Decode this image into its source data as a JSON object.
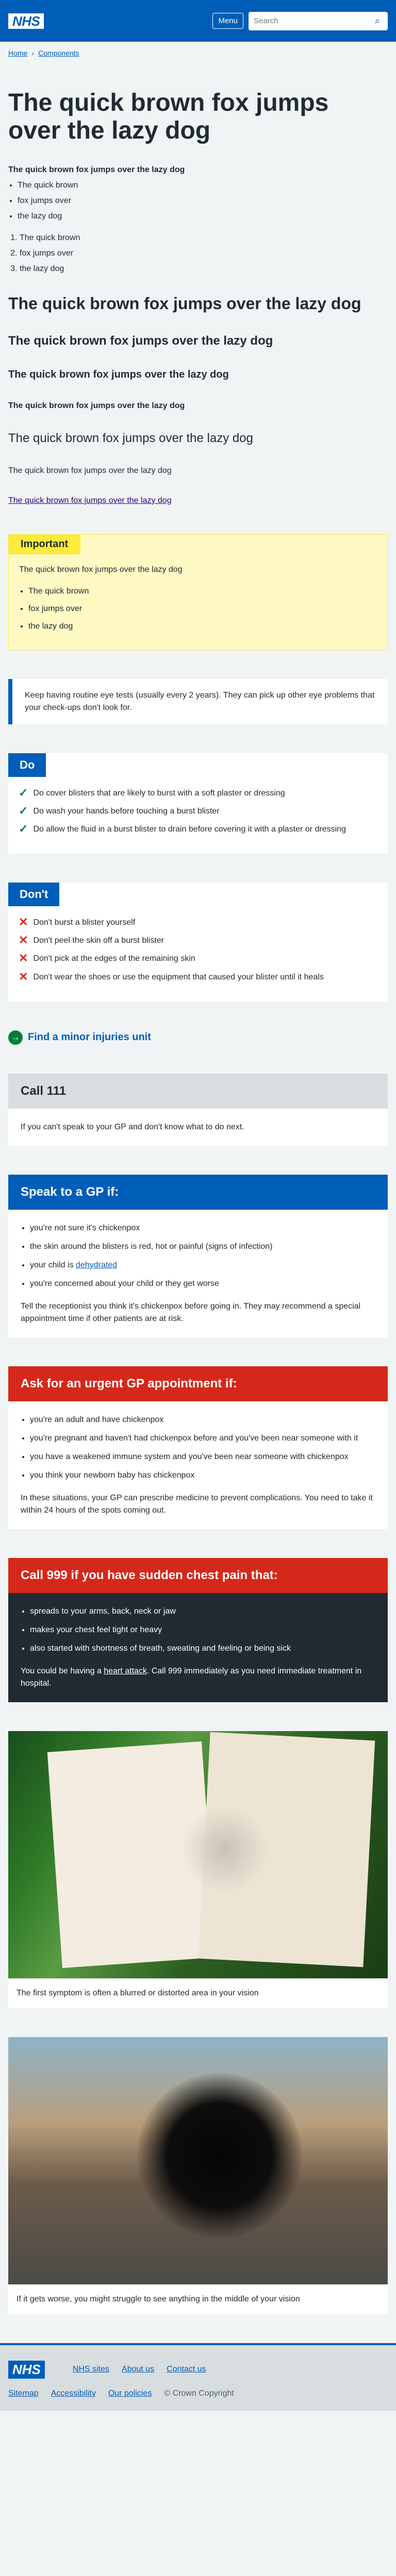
{
  "header": {
    "logo_text": "NHS",
    "menu_label": "Menu",
    "search_placeholder": "Search"
  },
  "breadcrumb": {
    "items": [
      "Home",
      "Components"
    ]
  },
  "page_title": "The quick brown fox jumps over the lazy dog",
  "content": {
    "bold_text": "The quick brown fox jumps over the lazy dog",
    "bullets": [
      "The quick brown",
      "fox jumps over",
      "the lazy dog"
    ],
    "numbered": [
      "The quick brown",
      "fox jumps over",
      "the lazy dog"
    ],
    "heading_xl": "The quick brown fox jumps over the lazy dog",
    "heading_l": "The quick brown fox jumps over the lazy dog",
    "heading_m": "The quick brown fox jumps over the lazy dog",
    "heading_s": "The quick brown fox jumps over the lazy dog",
    "body_large": "The quick brown fox jumps over the lazy dog",
    "body_medium": "The quick brown fox jumps over the lazy dog",
    "link": "The quick brown fox jumps over the lazy dog"
  },
  "important": {
    "label": "Important",
    "text": "The quick brown fox jumps over the lazy dog",
    "items": [
      "The quick brown",
      "fox jumps over",
      "the lazy dog"
    ]
  },
  "inset_text": "Keep having routine eye tests (usually every 2 years). They can pick up other eye problems that your check-ups don't look for.",
  "do_list": {
    "label": "Do",
    "items": [
      "Do cover blisters that are likely to burst with a soft plaster or dressing",
      "Do wash your hands before touching a burst blister",
      "Do allow the fluid in a burst blister to drain before covering it with a plaster or dressing"
    ]
  },
  "dont_list": {
    "label": "Don't",
    "items": [
      "Don't burst a blister yourself",
      "Don't peel the skin off a burst blister",
      "Don't pick at the edges of the remaining skin",
      "Don't wear the shoes or use the equipment that caused your blister until it heals"
    ]
  },
  "action_link": "Find a minor injuries unit",
  "care_non": {
    "heading": "Call 111",
    "text": "If you can't speak to your GP and don't know what to do next."
  },
  "care_nonurgent": {
    "heading": "Speak to a GP if:",
    "items": [
      "you're not sure it's chickenpox",
      "the skin around the blisters is red, hot or painful (signs of infection)",
      "your child is ",
      "you're concerned about your child or they get worse"
    ],
    "dehydrated_link": "dehydrated",
    "text": "Tell the receptionist you think it's chickenpox before going in. They may recommend a special appointment time if other patients are at risk."
  },
  "care_urgent": {
    "heading": "Ask for an urgent GP appointment if:",
    "items": [
      "you're an adult and have chickenpox",
      "you're pregnant and haven't had chickenpox before and you've been near someone with it",
      "you have a weakened immune system and you've been near someone with chickenpox",
      "you think your newborn baby has chickenpox"
    ],
    "text": "In these situations, your GP can prescribe medicine to prevent complications. You need to take it within 24 hours of the spots coming out."
  },
  "care_emergency": {
    "heading": "Call 999 if you have sudden chest pain that:",
    "items": [
      "spreads to your arms, back, neck or jaw",
      "makes your chest feel tight or heavy",
      "also started with shortness of breath, sweating and feeling or being sick"
    ],
    "text_before": "You could be having a ",
    "heart_attack_link": "heart attack",
    "text_after": ". Call 999 immediately as you need immediate treatment in hospital."
  },
  "figures": [
    {
      "caption": "The first symptom is often a blurred or distorted area in your vision"
    },
    {
      "caption": "If it gets worse, you might struggle to see anything in the middle of your vision"
    }
  ],
  "footer": {
    "logo_text": "NHS",
    "top_links": [
      "NHS sites",
      "About us",
      "Contact us"
    ],
    "bottom_links": [
      "Sitemap",
      "Accessibility",
      "Our policies"
    ],
    "copyright": "© Crown Copyright"
  }
}
